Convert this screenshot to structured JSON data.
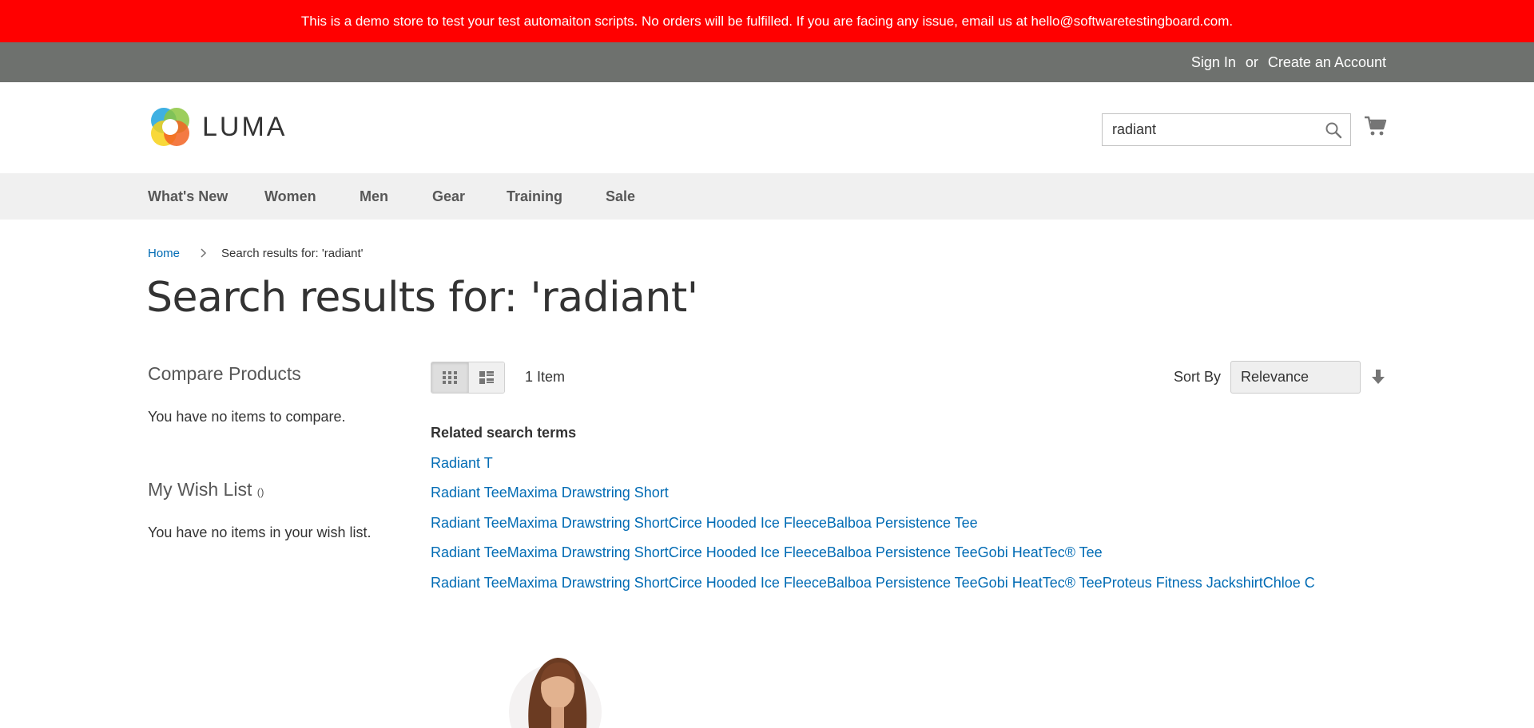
{
  "banner": {
    "text": "This is a demo store to test your test automaiton scripts. No orders will be fulfilled. If you are facing any issue, email us at hello@softwaretestingboard.com."
  },
  "top_links": {
    "sign_in": "Sign In",
    "or": "or",
    "create_account": "Create an Account"
  },
  "logo": {
    "text": "LUMA"
  },
  "search": {
    "value": "radiant",
    "placeholder": ""
  },
  "nav": [
    {
      "label": "What's New"
    },
    {
      "label": "Women"
    },
    {
      "label": "Men"
    },
    {
      "label": "Gear"
    },
    {
      "label": "Training"
    },
    {
      "label": "Sale"
    }
  ],
  "breadcrumb": {
    "home": "Home",
    "current": "Search results for: 'radiant'"
  },
  "page_title": "Search results for: 'radiant'",
  "sidebar": {
    "compare_title": "Compare Products",
    "compare_empty": "You have no items to compare.",
    "wishlist_title": "My Wish List",
    "wishlist_count": "()",
    "wishlist_empty": "You have no items in your wish list."
  },
  "toolbar": {
    "amount": "1 Item",
    "sort_label": "Sort By",
    "sort_value": "Relevance"
  },
  "related": {
    "title": "Related search terms",
    "terms": [
      "Radiant T",
      "Radiant TeeMaxima Drawstring Short",
      "Radiant TeeMaxima Drawstring ShortCirce Hooded Ice FleeceBalboa Persistence Tee",
      "Radiant TeeMaxima Drawstring ShortCirce Hooded Ice FleeceBalboa Persistence TeeGobi HeatTec® Tee",
      "Radiant TeeMaxima Drawstring ShortCirce Hooded Ice FleeceBalboa Persistence TeeGobi HeatTec® TeeProteus Fitness JackshirtChloe C"
    ]
  },
  "colors": {
    "banner_bg": "#ff0000",
    "topbar_bg": "#6e716e",
    "nav_bg": "#f0f0f0",
    "link": "#006bb4"
  },
  "icons": {
    "logo": "luma-logo-icon",
    "search": "search-icon",
    "cart": "cart-icon",
    "grid": "grid-view-icon",
    "list": "list-view-icon",
    "sort_direction": "sort-arrow-down-icon",
    "breadcrumb_separator": "chevron-right-icon"
  }
}
